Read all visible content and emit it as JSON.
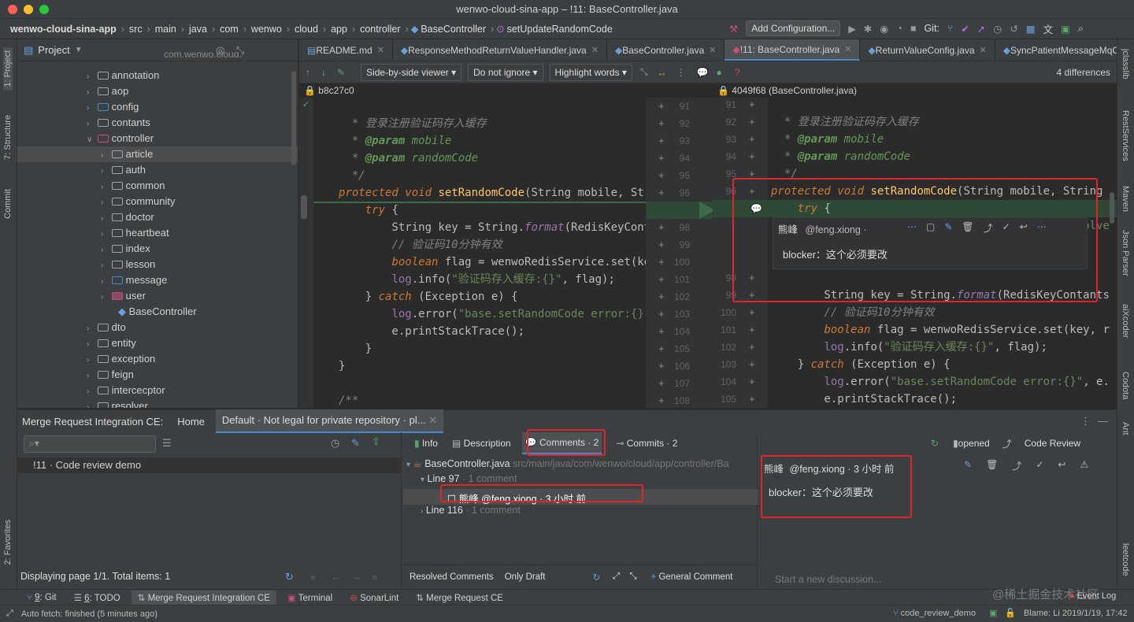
{
  "window": {
    "title": "wenwo-cloud-sina-app – !11: BaseController.java"
  },
  "breadcrumb": [
    "wenwo-cloud-sina-app",
    "src",
    "main",
    "java",
    "com",
    "wenwo",
    "cloud",
    "app",
    "controller",
    "BaseController",
    "setUpdateRandomCode"
  ],
  "toolbar": {
    "add_config": "Add Configuration...",
    "git_label": "Git:"
  },
  "left_strip": {
    "project": "1: Project",
    "structure": "7: Structure",
    "commit": "Commit",
    "favorites": "2: Favorites"
  },
  "right_strip": [
    "jclasslib",
    "RestServices",
    "Maven",
    "Json Parser",
    "aiXcoder",
    "Codota",
    "Ant",
    "leetcode"
  ],
  "project": {
    "title": "Project",
    "truncated_root": "com.wenwo.cloud.app",
    "items": [
      {
        "label": "annotation",
        "depth": 1
      },
      {
        "label": "aop",
        "depth": 1
      },
      {
        "label": "config",
        "depth": 1
      },
      {
        "label": "contants",
        "depth": 1
      },
      {
        "label": "controller",
        "depth": 1,
        "open": true
      },
      {
        "label": "article",
        "depth": 2,
        "selected": true
      },
      {
        "label": "auth",
        "depth": 2
      },
      {
        "label": "common",
        "depth": 2
      },
      {
        "label": "community",
        "depth": 2
      },
      {
        "label": "doctor",
        "depth": 2
      },
      {
        "label": "heartbeat",
        "depth": 2
      },
      {
        "label": "index",
        "depth": 2
      },
      {
        "label": "lesson",
        "depth": 2
      },
      {
        "label": "message",
        "depth": 2
      },
      {
        "label": "user",
        "depth": 2
      },
      {
        "label": "BaseController",
        "depth": 2,
        "file": true
      },
      {
        "label": "dto",
        "depth": 1
      },
      {
        "label": "entity",
        "depth": 1
      },
      {
        "label": "exception",
        "depth": 1
      },
      {
        "label": "feign",
        "depth": 1
      },
      {
        "label": "intercecptor",
        "depth": 1
      },
      {
        "label": "resolver",
        "depth": 1
      }
    ]
  },
  "tabs": [
    {
      "label": "README.md"
    },
    {
      "label": "ResponseMethodReturnValueHandler.java"
    },
    {
      "label": "BaseController.java"
    },
    {
      "label": "!11: BaseController.java",
      "active": true
    },
    {
      "label": "ReturnValueConfig.java"
    },
    {
      "label": "SyncPatientMessageMqCon"
    }
  ],
  "diff_toolbar": {
    "viewer": "Side-by-side viewer",
    "ignore": "Do not ignore",
    "highlight": "Highlight words",
    "differences": "4 differences"
  },
  "diff": {
    "left_rev": "b8c27c0",
    "right_rev": "4049f68 (BaseController.java)",
    "left_lines": [
      "91",
      "92",
      "93",
      "94",
      "95",
      "96",
      "97",
      "98",
      "99",
      "100",
      "101",
      "102",
      "103",
      "104",
      "105",
      "106",
      "107",
      "108"
    ],
    "right_lines": [
      "91",
      "92",
      "93",
      "94",
      "95",
      "96",
      "97",
      "",
      "",
      "",
      "98",
      "99",
      "100",
      "101",
      "102",
      "103",
      "104",
      "105"
    ]
  },
  "inline_comment": {
    "author": "熊峰",
    "handle": "@feng.xiong",
    "dot": "·",
    "body": "blocker：这个必须要改"
  },
  "bottom": {
    "tool_title": "Merge Request Integration CE:",
    "home_tab": "Home",
    "repo_tab": "Default · Not legal for private repository · pl...",
    "mr_item": "!11 · Code review demo",
    "pagination": "Displaying page 1/1. Total items: 1",
    "subtabs": {
      "info": "Info",
      "description": "Description",
      "comments": "Comments · 2",
      "commits": "Commits · 2"
    },
    "opened": "opened",
    "code_review": "Code Review",
    "file": "BaseController.java",
    "file_path": "src/main/java/com/wenwo/cloud/app/controller/Ba",
    "line97": "Line 97",
    "line97_count": "· 1 comment",
    "comment_row": "熊峰 @feng.xiong · 3 小时 前",
    "line116": "Line 116",
    "line116_count": "· 1 comment",
    "resolved": "Resolved Comments",
    "only_draft": "Only Draft",
    "general_comment": "General Comment",
    "detail_author": "熊峰",
    "detail_meta": "@feng.xiong · 3 小时 前",
    "detail_body": "blocker：这个必须要改",
    "discussion_placeholder": "Start a new discussion..."
  },
  "tool_tabs": [
    {
      "num": "9",
      "label": ": Git"
    },
    {
      "num": "6",
      "label": ": TODO"
    },
    {
      "num": "",
      "label": "Merge Request Integration CE"
    },
    {
      "num": "",
      "label": "Terminal"
    },
    {
      "num": "",
      "label": "SonarLint"
    },
    {
      "num": "",
      "label": "Merge Request CE"
    }
  ],
  "status": {
    "left": "Auto fetch: finished (5 minutes ago)",
    "branch": "code_review_demo",
    "blame": "Blame: Li 2019/1/19, 17:42",
    "event_log": "Event Log",
    "watermark": "@稀土掘金技术社区"
  }
}
